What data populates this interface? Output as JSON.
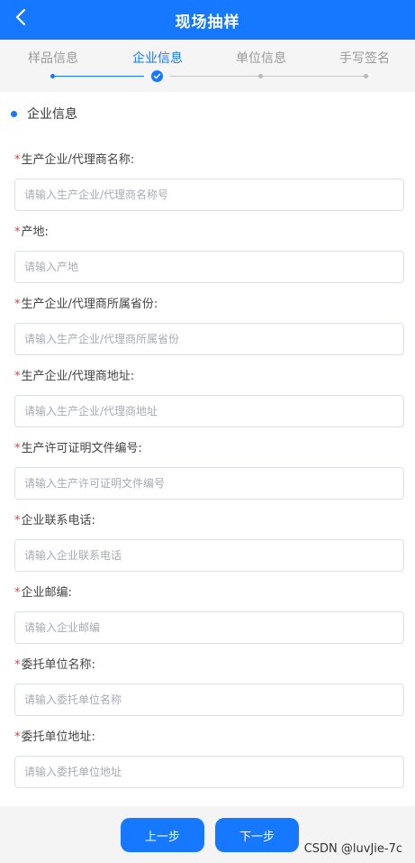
{
  "header": {
    "title": "现场抽样",
    "back_icon": "chevron-left-icon"
  },
  "steps": [
    {
      "label": "样品信息",
      "status": "done"
    },
    {
      "label": "企业信息",
      "status": "current"
    },
    {
      "label": "单位信息",
      "status": "pending"
    },
    {
      "label": "手写签名",
      "status": "pending"
    }
  ],
  "section": {
    "title": "企业信息"
  },
  "fields": [
    {
      "required": "*",
      "label": "生产企业/代理商名称:",
      "placeholder": "请输入生产企业/代理商名称号",
      "value": ""
    },
    {
      "required": "*",
      "label": "产地:",
      "placeholder": "请输入产地",
      "value": ""
    },
    {
      "required": "*",
      "label": "生产企业/代理商所属省份:",
      "placeholder": "请输入生产企业/代理商所属省份",
      "value": ""
    },
    {
      "required": "*",
      "label": "生产企业/代理商地址:",
      "placeholder": "请输入生产企业/代理商地址",
      "value": ""
    },
    {
      "required": "*",
      "label": "生产许可证明文件编号:",
      "placeholder": "请输入生产许可证明文件编号",
      "value": ""
    },
    {
      "required": "*",
      "label": "企业联系电话:",
      "placeholder": "请输入企业联系电话",
      "value": ""
    },
    {
      "required": "*",
      "label": "企业邮编:",
      "placeholder": "请输入企业邮编",
      "value": ""
    },
    {
      "required": "*",
      "label": "委托单位名称:",
      "placeholder": "请输入委托单位名称",
      "value": ""
    },
    {
      "required": "*",
      "label": "委托单位地址:",
      "placeholder": "请输入委托单位地址",
      "value": ""
    }
  ],
  "footer": {
    "prev_label": "上一步",
    "next_label": "下一步",
    "watermark": "CSDN @luvJie-7c"
  },
  "colors": {
    "primary": "#1677ff",
    "required": "#e34234"
  }
}
